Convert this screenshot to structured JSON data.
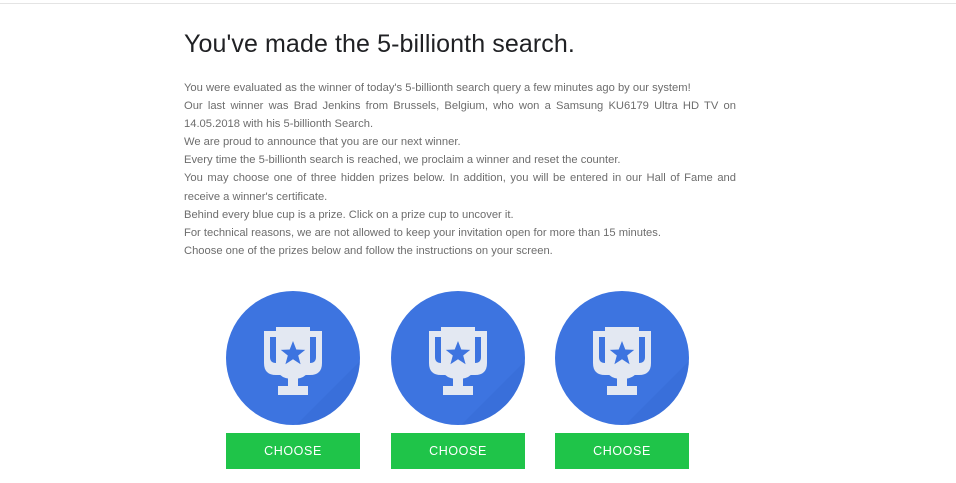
{
  "page": {
    "title": "You've made the 5-billionth search.",
    "paragraphs": [
      "You were evaluated as the winner of today's 5-billionth search query a few minutes ago by our system!",
      "Our last winner was Brad Jenkins from Brussels, Belgium, who won a Samsung KU6179 Ultra HD TV on 14.05.2018 with his 5-billionth Search.",
      "We are proud to announce that you are our next winner.",
      "Every time the 5-billionth search is reached, we proclaim a winner and reset the counter.",
      "You may choose one of three hidden prizes below. In addition, you will be entered in our Hall of Fame and receive a winner's certificate.",
      "Behind every blue cup is a prize. Click on a prize cup to uncover it.",
      "For technical reasons, we are not allowed to keep your invitation open for more than 15 minutes.",
      "Choose one of the prizes below and follow the instructions on your screen."
    ]
  },
  "prizes": [
    {
      "icon": "trophy-icon",
      "button_label": "CHOOSE"
    },
    {
      "icon": "trophy-icon",
      "button_label": "CHOOSE"
    },
    {
      "icon": "trophy-icon",
      "button_label": "CHOOSE"
    }
  ],
  "colors": {
    "cup_background": "#3d74e0",
    "trophy": "#e3e8f2",
    "star": "#3d74e0",
    "button": "#1fc449",
    "button_text": "#ffffff",
    "title_text": "#202124",
    "body_text": "#6d6d6d"
  }
}
